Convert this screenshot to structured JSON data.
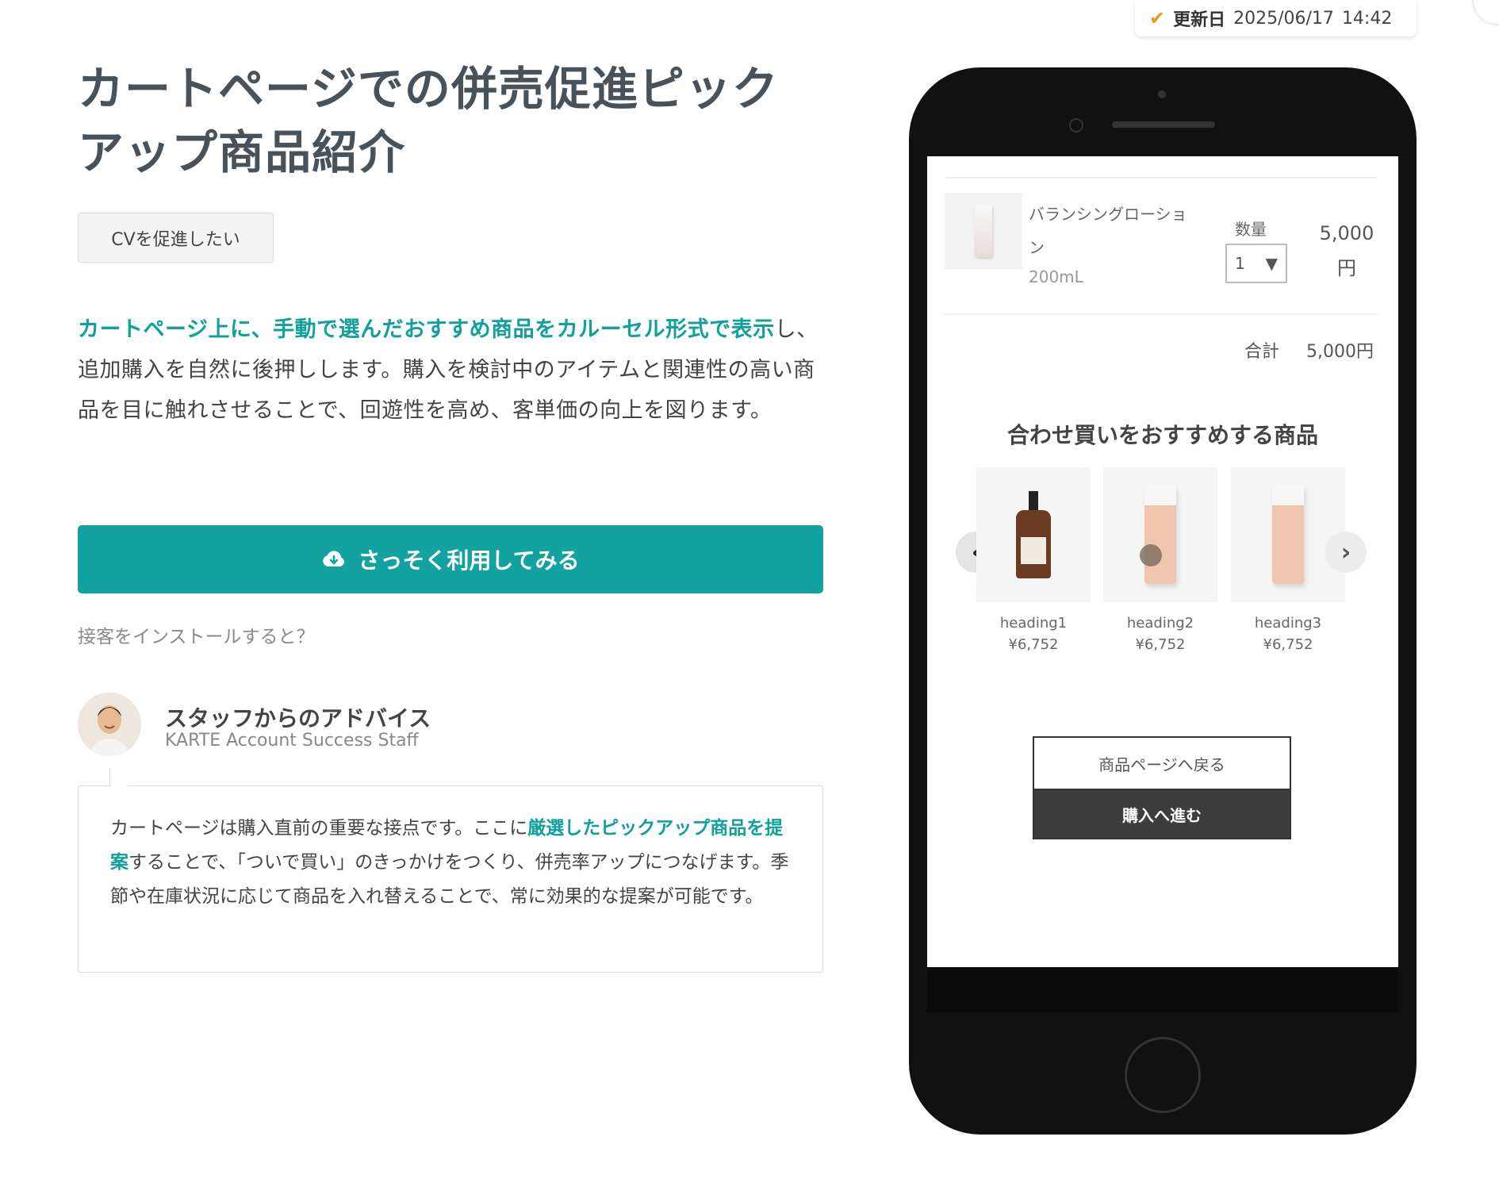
{
  "update": {
    "label": "更新日",
    "date": "2025/06/17",
    "time": "14:42"
  },
  "page": {
    "title": "カートページでの併売促進ピックアップ商品紹介",
    "tag": "CVを促進したい",
    "description_highlight": "カートページ上に、手動で選んだおすすめ商品をカルーセル形式で表示",
    "description_rest": "し、追加購入を自然に後押しします。購入を検討中のアイテムと関連性の高い商品を目に触れさせることで、回遊性を高め、客単価の向上を図ります。",
    "cta_label": "さっそく利用してみる",
    "install_link": "接客をインストールすると？"
  },
  "staff": {
    "title": "スタッフからのアドバイス",
    "role": "KARTE Account Success Staff",
    "advice_part1": "カートページは購入直前の重要な接点です。ここに",
    "advice_highlight": "厳選したピックアップ商品を提案",
    "advice_part2": "することで、「ついで買い」のきっかけをつくり、併売率アップにつなげます。季節や在庫状況に応じて商品を入れ替えることで、常に効果的な提案が可能です。"
  },
  "phone_screen": {
    "cart_item": {
      "name": "バランシングローション",
      "size": "200mL",
      "qty_label": "数量",
      "qty_value": "1",
      "price": "5,000",
      "price_unit": "円"
    },
    "total_label": "合計",
    "total_value": "5,000円",
    "recommend_title": "合わせ買いをおすすめする商品",
    "products": [
      {
        "name": "heading1",
        "price": "¥6,752"
      },
      {
        "name": "heading2",
        "price": "¥6,752"
      },
      {
        "name": "heading3",
        "price": "¥6,752"
      }
    ],
    "back_button": "商品ページへ戻る",
    "buy_button": "購入へ進む"
  },
  "colors": {
    "accent": "#13a29f",
    "title": "#47525a",
    "check": "#e99a1e"
  }
}
